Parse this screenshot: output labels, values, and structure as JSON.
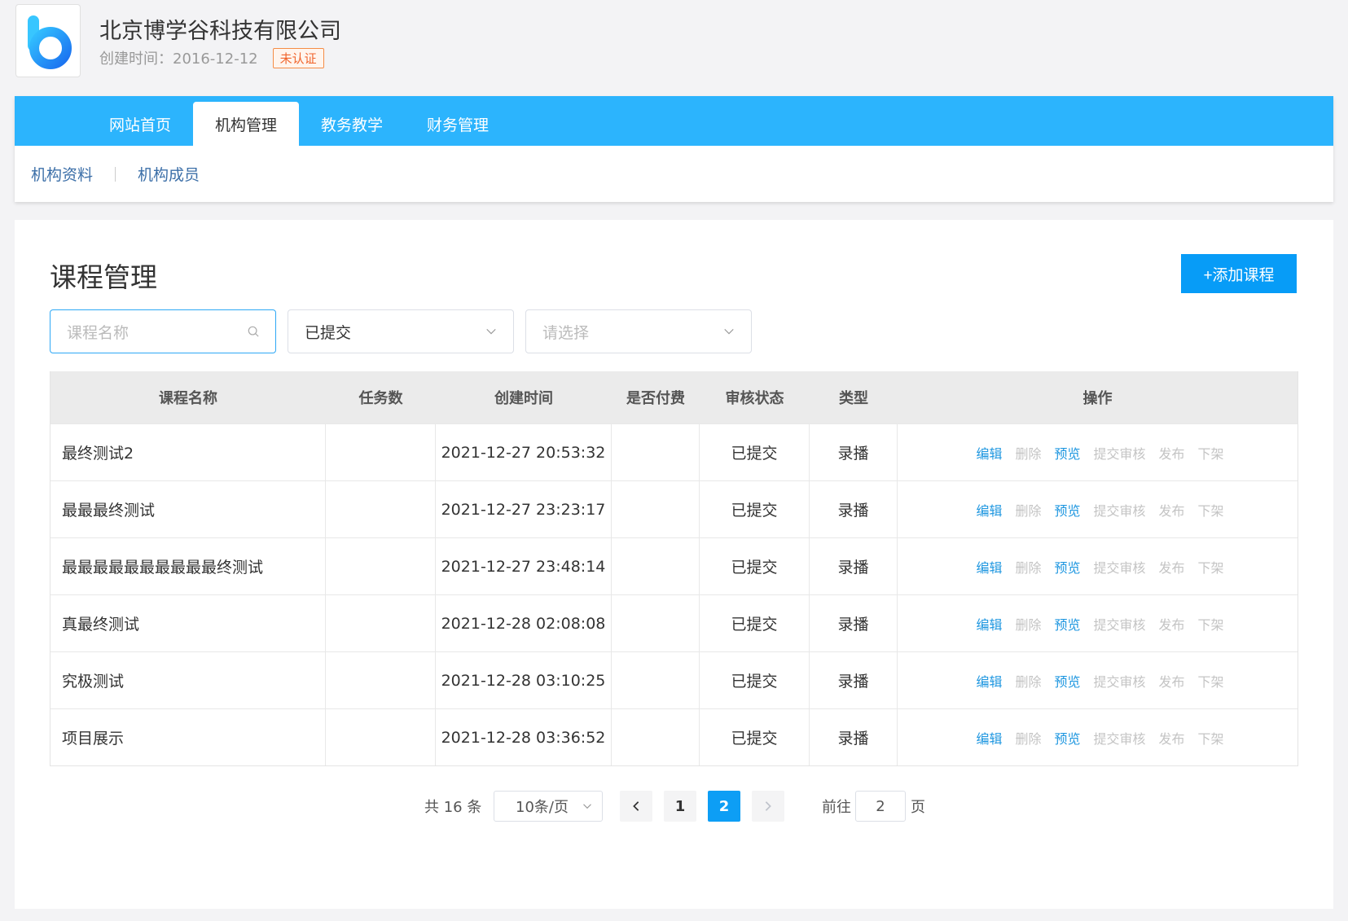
{
  "org": {
    "name": "北京博学谷科技有限公司",
    "created": "创建时间：2016-12-12",
    "badge": "未认证"
  },
  "nav": {
    "tabs": [
      {
        "label": "网站首页",
        "active": false
      },
      {
        "label": "机构管理",
        "active": true
      },
      {
        "label": "教务教学",
        "active": false
      },
      {
        "label": "财务管理",
        "active": false
      }
    ],
    "sub": [
      "机构资料",
      "机构成员"
    ]
  },
  "page": {
    "title": "课程管理",
    "add_label": "+添加课程"
  },
  "filters": {
    "name_placeholder": "课程名称",
    "status_value": "已提交",
    "type_placeholder": "请选择"
  },
  "table": {
    "headers": [
      "课程名称",
      "任务数",
      "创建时间",
      "是否付费",
      "审核状态",
      "类型",
      "操作"
    ],
    "rows": [
      {
        "name": "最终测试2",
        "tasks": "",
        "created": "2021-12-27 20:53:32",
        "paid": "",
        "status": "已提交",
        "type": "录播"
      },
      {
        "name": "最最最终测试",
        "tasks": "",
        "created": "2021-12-27 23:23:17",
        "paid": "",
        "status": "已提交",
        "type": "录播"
      },
      {
        "name": "最最最最最最最最最最终测试",
        "tasks": "",
        "created": "2021-12-27 23:48:14",
        "paid": "",
        "status": "已提交",
        "type": "录播"
      },
      {
        "name": "真最终测试",
        "tasks": "",
        "created": "2021-12-28 02:08:08",
        "paid": "",
        "status": "已提交",
        "type": "录播"
      },
      {
        "name": "究极测试",
        "tasks": "",
        "created": "2021-12-28 03:10:25",
        "paid": "",
        "status": "已提交",
        "type": "录播"
      },
      {
        "name": "项目展示",
        "tasks": "",
        "created": "2021-12-28 03:36:52",
        "paid": "",
        "status": "已提交",
        "type": "录播"
      }
    ],
    "actions": [
      {
        "label": "编辑",
        "enabled": true
      },
      {
        "label": "删除",
        "enabled": false
      },
      {
        "label": "预览",
        "enabled": true
      },
      {
        "label": "提交审核",
        "enabled": false
      },
      {
        "label": "发布",
        "enabled": false
      },
      {
        "label": "下架",
        "enabled": false
      }
    ]
  },
  "pagination": {
    "total": "共 16 条",
    "page_size": "10条/页",
    "pages": [
      "1",
      "2"
    ],
    "current": "2",
    "goto_label": "前往",
    "goto_value": "2",
    "goto_unit": "页"
  },
  "colors": {
    "accent": "#2cb4fd",
    "primary": "#079cf7",
    "link": "#1f97e0",
    "disabled": "#c4c4c4",
    "badge": "#f0642c"
  }
}
